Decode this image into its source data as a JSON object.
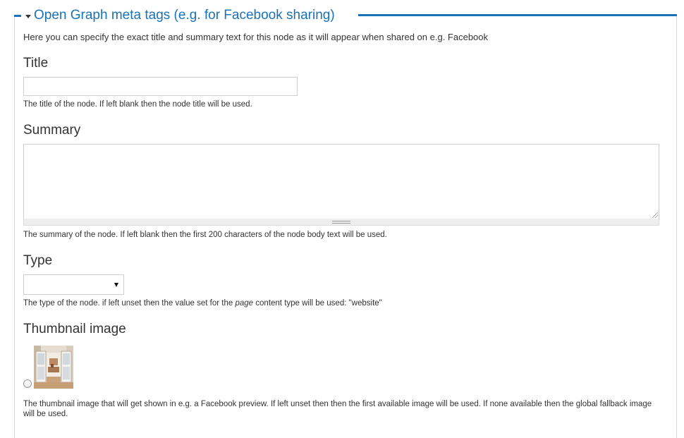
{
  "fieldset": {
    "legend": "Open Graph meta tags (e.g. for Facebook sharing)"
  },
  "intro": "Here you can specify the exact title and summary text for this node as it will appear when shared on e.g. Facebook",
  "title_field": {
    "label": "Title",
    "value": "",
    "description": "The title of the node. If left blank then the node title will be used."
  },
  "summary_field": {
    "label": "Summary",
    "value": "",
    "description": "The summary of the node. If left blank then the first 200 characters of the node body text will be used."
  },
  "type_field": {
    "label": "Type",
    "selected": "",
    "description_before": "The type of the node. if left unset then the value set for the ",
    "description_em": "page",
    "description_after": " content type will be used: \"website\""
  },
  "thumbnail_field": {
    "label": "Thumbnail image",
    "description": "The thumbnail image that will get shown in e.g. a Facebook preview. If left unset then then the first available image will be used. If none available then the global fallback image will be used."
  },
  "colors": {
    "accent": "#1a72b8",
    "border": "#cfcfcf"
  }
}
